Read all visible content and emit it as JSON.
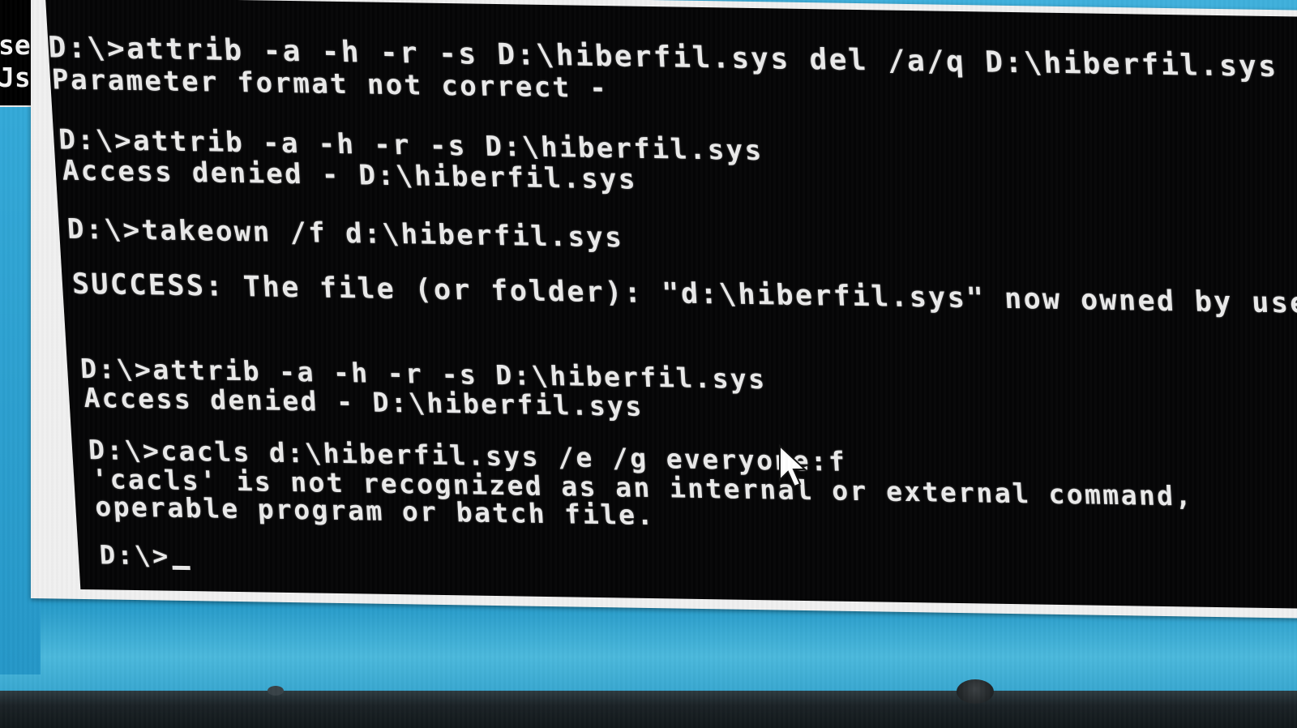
{
  "background_window": {
    "line1": "se",
    "line2": "Jse"
  },
  "console": {
    "lines": [
      "D:\\>attrib -a -h -r -s D:\\hiberfil.sys del /a/q D:\\hiberfil.sys",
      "Parameter format not correct -",
      "D:\\>attrib -a -h -r -s D:\\hiberfil.sys",
      "Access denied - D:\\hiberfil.sys",
      "D:\\>takeown /f d:\\hiberfil.sys",
      "SUCCESS: The file (or folder): \"d:\\hiberfil.sys\" now owned by user",
      "D:\\>attrib -a -h -r -s D:\\hiberfil.sys",
      "Access denied - D:\\hiberfil.sys",
      "D:\\>cacls d:\\hiberfil.sys /e /g everyone:f",
      "'cacls' is not recognized as an internal or external command,",
      "operable program or batch file.",
      "D:\\>"
    ]
  },
  "colors": {
    "console_bg": "#050506",
    "console_text": "#ebebeb",
    "desktop": "#2aa3d3"
  }
}
